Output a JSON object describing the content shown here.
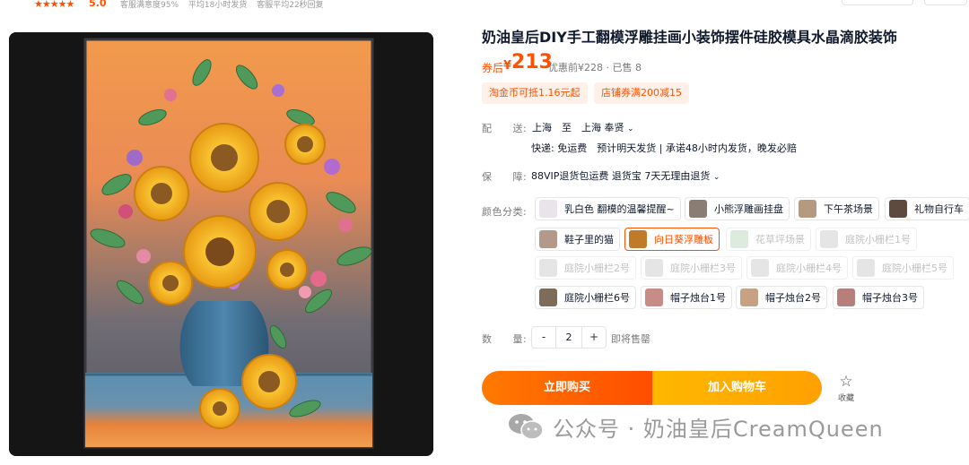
{
  "shop": {
    "stars": "★★★★★",
    "score": "5.0",
    "metrics": [
      "客服满意度95%",
      "平均18小时发货",
      "客服平均22秒回复"
    ]
  },
  "product": {
    "title": "奶油皇后DIY手工翻模浮雕挂画小装饰摆件硅胶模具水晶滴胶装饰",
    "price_prefix": "券后",
    "currency": "¥",
    "price": "213",
    "original_price_info": "优惠前¥228 · 已售 8",
    "coupons": [
      "淘金币可抵1.16元起",
      "店铺券满200减15"
    ]
  },
  "delivery": {
    "label": "配　　送:",
    "route": "上海　至　上海 奉贤",
    "detail": "快递: 免运费　预计明天发货 | 承诺48小时内发货，晚发必赔"
  },
  "guarantee": {
    "label": "保　　障:",
    "text": "88VIP退货包运费 退货宝 7天无理由退货"
  },
  "sku": {
    "label": "颜色分类:",
    "options": [
      {
        "label": "乳白色 翻模的温馨提醒~",
        "state": "normal",
        "thumb_color": "#e9e4ea"
      },
      {
        "label": "小熊浮雕画挂盘",
        "state": "normal",
        "thumb_color": "#8a7d74"
      },
      {
        "label": "下午茶场景",
        "state": "normal",
        "thumb_color": "#b49a7e"
      },
      {
        "label": "礼物自行车",
        "state": "normal",
        "thumb_color": "#5c4b3e"
      },
      {
        "label": "鞋子里的猫",
        "state": "normal",
        "thumb_color": "#b2998a"
      },
      {
        "label": "向日葵浮雕板",
        "state": "selected",
        "thumb_color": "#c07b2a"
      },
      {
        "label": "花草坪场景",
        "state": "disabled",
        "thumb_color": "#9ec7a0"
      },
      {
        "label": "庭院小栅栏1号",
        "state": "disabled",
        "thumb_color": "#b4b4b4"
      },
      {
        "label": "庭院小栅栏2号",
        "state": "disabled",
        "thumb_color": "#b4b4b4"
      },
      {
        "label": "庭院小栅栏3号",
        "state": "disabled",
        "thumb_color": "#b4b4b4"
      },
      {
        "label": "庭院小栅栏4号",
        "state": "disabled",
        "thumb_color": "#b4b4b4"
      },
      {
        "label": "庭院小栅栏5号",
        "state": "disabled",
        "thumb_color": "#b4b4b4"
      },
      {
        "label": "庭院小栅栏6号",
        "state": "normal",
        "thumb_color": "#7e6c5a"
      },
      {
        "label": "帽子烛台1号",
        "state": "normal",
        "thumb_color": "#c88c88"
      },
      {
        "label": "帽子烛台2号",
        "state": "normal",
        "thumb_color": "#c6a283"
      },
      {
        "label": "帽子烛台3号",
        "state": "normal",
        "thumb_color": "#b67f7b"
      }
    ]
  },
  "quantity": {
    "label": "数　　量:",
    "minus": "-",
    "value": "2",
    "plus": "+",
    "stock_text": "即将售罄"
  },
  "actions": {
    "buy_now": "立即购买",
    "add_to_cart": "加入购物车",
    "favorite_icon": "☆",
    "favorite_label": "收藏"
  },
  "watermark": {
    "text": "公众号 · 奶油皇后CreamQueen"
  },
  "colors": {
    "accent": "#ff5000",
    "cart": "#ffa800"
  }
}
